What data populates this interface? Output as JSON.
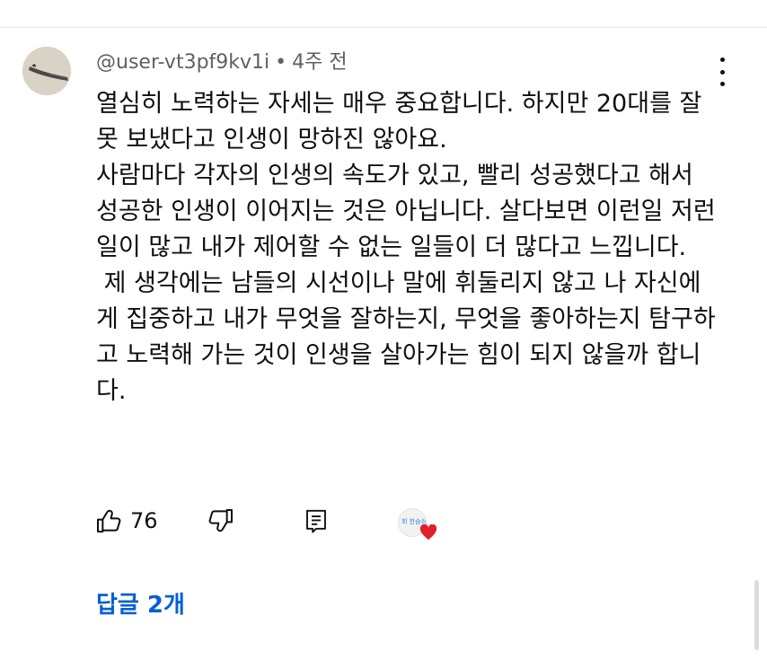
{
  "comment": {
    "author": "@user-vt3pf9kv1i",
    "separator": "•",
    "time": "4주 전",
    "paragraphs": [
      "열심히 노력하는 자세는 매우 중요합니다. 하지만 20대를 잘못 보냈다고 인생이 망하진 않아요.",
      "사람마다 각자의 인생의 속도가 있고, 빨리 성공했다고 해서 성공한 인생이 이어지는 것은 아닙니다. 살다보면 이런일 저런일이 많고 내가 제어할 수 없는 일들이 더 많다고 느낍니다.",
      " 제 생각에는 남들의 시선이나 말에 휘둘리지 않고 나 자신에게 집중하고 내가 무엇을 잘하는지, 무엇을 좋아하는지 탐구하고 노력해 가는 것이 인생을 살아가는 힘이 되지 않을까 합니다."
    ],
    "like_count": "76",
    "creator_avatar_text": "회 한숨쉬",
    "replies_label": "답글 2개"
  },
  "icons": {
    "like": "thumbs-up-icon",
    "dislike": "thumbs-down-icon",
    "reply": "reply-comment-icon",
    "more": "more-vert-icon",
    "heart": "heart-icon"
  },
  "colors": {
    "link": "#065fd4",
    "meta_text": "#606060",
    "heart": "#e0202a"
  }
}
